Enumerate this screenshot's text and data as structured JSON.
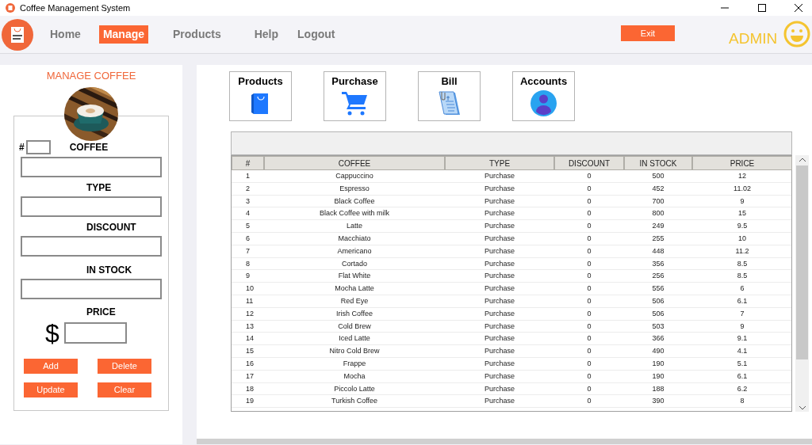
{
  "window": {
    "title": "Coffee Management System"
  },
  "nav": [
    {
      "label": "Home",
      "selected": false
    },
    {
      "label": "Manage",
      "selected": true
    },
    {
      "label": "Products",
      "selected": false
    },
    {
      "label": "Help",
      "selected": false
    },
    {
      "label": "Logout",
      "selected": false
    }
  ],
  "exit_button": "Exit",
  "user": "ADMIN",
  "form": {
    "title": "MANAGE COFFEE",
    "id_label": "#",
    "fields": [
      "COFFEE",
      "TYPE",
      "DISCOUNT",
      "IN STOCK",
      "PRICE"
    ],
    "currency": "$",
    "buttons": [
      "Add",
      "Delete",
      "Update",
      "Clear"
    ]
  },
  "tiles": [
    {
      "label": "Products",
      "kind": "bag"
    },
    {
      "label": "Purchase",
      "kind": "cart"
    },
    {
      "label": "Bill",
      "kind": "bill"
    },
    {
      "label": "Accounts",
      "kind": "account"
    }
  ],
  "table": {
    "columns": [
      "#",
      "COFFEE",
      "TYPE",
      "DISCOUNT",
      "IN STOCK",
      "PRICE"
    ],
    "rows": [
      [
        "1",
        "Cappuccino",
        "Purchase",
        "0",
        "500",
        "12"
      ],
      [
        "2",
        "Espresso",
        "Purchase",
        "0",
        "452",
        "11.02"
      ],
      [
        "3",
        "Black Coffee",
        "Purchase",
        "0",
        "700",
        "9"
      ],
      [
        "4",
        "Black Coffee with milk",
        "Purchase",
        "0",
        "800",
        "15"
      ],
      [
        "5",
        "Latte",
        "Purchase",
        "0",
        "249",
        "9.5"
      ],
      [
        "6",
        "Macchiato",
        "Purchase",
        "0",
        "255",
        "10"
      ],
      [
        "7",
        "Americano",
        "Purchase",
        "0",
        "448",
        "11.2"
      ],
      [
        "8",
        "Cortado",
        "Purchase",
        "0",
        "356",
        "8.5"
      ],
      [
        "9",
        "Flat White",
        "Purchase",
        "0",
        "256",
        "8.5"
      ],
      [
        "10",
        "Mocha Latte",
        "Purchase",
        "0",
        "556",
        "6"
      ],
      [
        "11",
        "Red Eye",
        "Purchase",
        "0",
        "506",
        "6.1"
      ],
      [
        "12",
        "Irish Coffee",
        "Purchase",
        "0",
        "506",
        "7"
      ],
      [
        "13",
        "Cold Brew",
        "Purchase",
        "0",
        "503",
        "9"
      ],
      [
        "14",
        "Iced Latte",
        "Purchase",
        "0",
        "366",
        "9.1"
      ],
      [
        "15",
        "Nitro Cold Brew",
        "Purchase",
        "0",
        "490",
        "4.1"
      ],
      [
        "16",
        "Frappe",
        "Purchase",
        "0",
        "190",
        "5.1"
      ],
      [
        "17",
        "Mocha",
        "Purchase",
        "0",
        "190",
        "6.1"
      ],
      [
        "18",
        "Piccolo Latte",
        "Purchase",
        "0",
        "188",
        "6.2"
      ],
      [
        "19",
        "Turkish Coffee",
        "Purchase",
        "0",
        "390",
        "8"
      ]
    ]
  }
}
